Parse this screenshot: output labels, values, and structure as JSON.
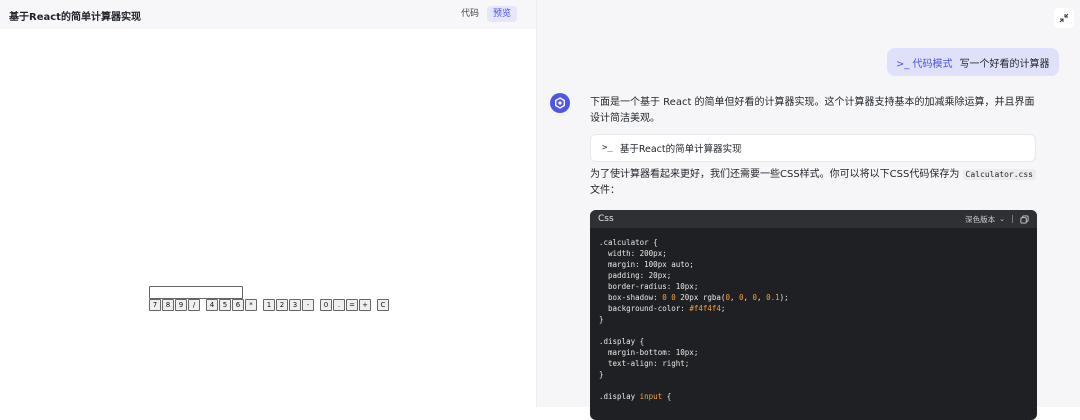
{
  "left": {
    "title": "基于React的简单计算器实现",
    "tabs": {
      "code": "代码",
      "preview": "预览"
    },
    "calculator": {
      "display_value": "",
      "keys": [
        "7",
        "8",
        "9",
        "/",
        "4",
        "5",
        "6",
        "*",
        "1",
        "2",
        "3",
        "-",
        "0",
        ".",
        "=",
        "+",
        "C"
      ]
    }
  },
  "right": {
    "user_message": {
      "mode": ">_ 代码模式",
      "text": "写一个好看的计算器"
    },
    "bot": {
      "intro": "下面是一个基于 React 的简单但好看的计算器实现。这个计算器支持基本的加减乘除运算，并且界面设计简洁美观。",
      "code_card_prompt": ">_",
      "code_card_title": "基于React的简单计算器实现",
      "css_intro_before": "为了使计算器看起来更好，我们还需要一些CSS样式。你可以将以下CSS代码保存为",
      "css_file": "Calculator.css",
      "css_intro_after": "文件：",
      "code_block": {
        "language": "Css",
        "theme_label": "深色版本",
        "lines": [
          ".calculator {",
          "  width: 200px;",
          "  margin: 100px auto;",
          "  padding: 20px;",
          "  border-radius: 10px;",
          "  box-shadow: 0 0 20px rgba(0, 0, 0, 0.1);",
          "  background-color: #f4f4f4;",
          "}",
          "",
          ".display {",
          "  margin-bottom: 10px;",
          "  text-align: right;",
          "}",
          "",
          ".display input {"
        ]
      }
    }
  },
  "colors": {
    "accent": "#4d53e8",
    "code_bg": "#1f2024",
    "code_header_bg": "#2e3036",
    "highlight": "#f6a13a"
  }
}
